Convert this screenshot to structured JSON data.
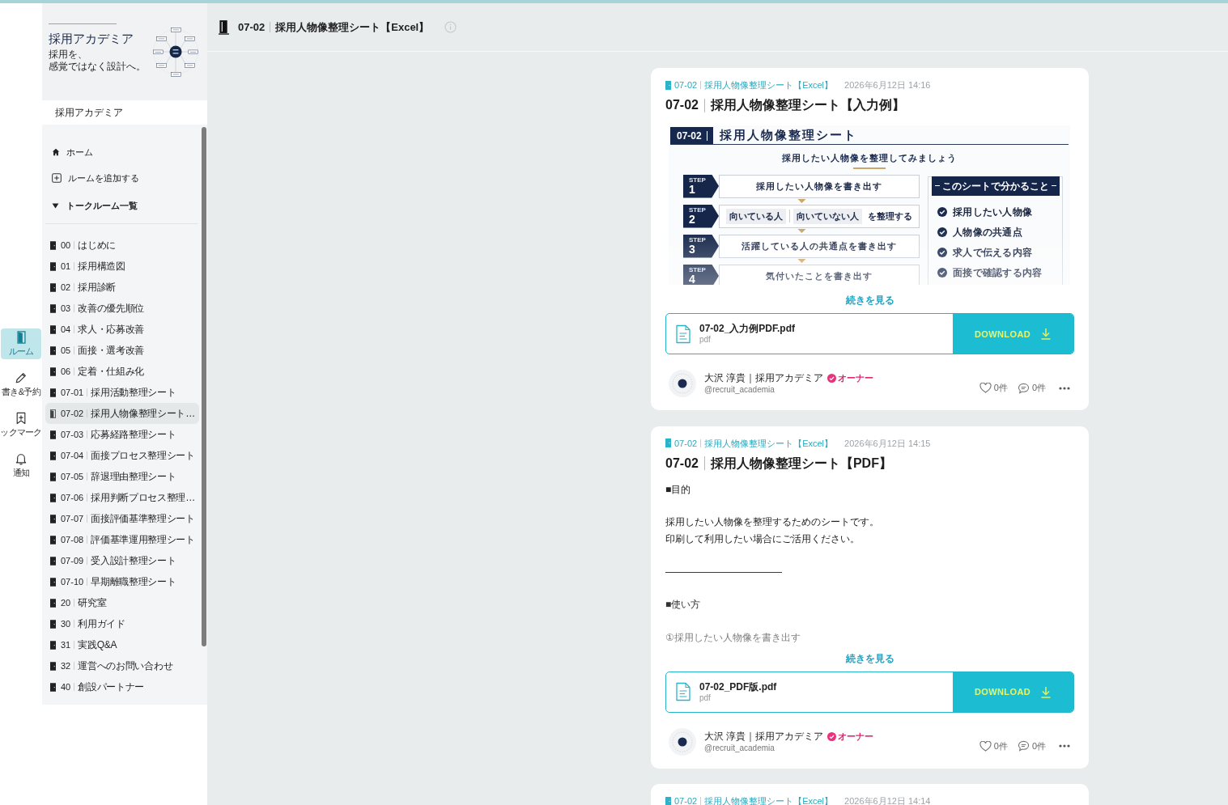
{
  "rail": {
    "items": [
      {
        "kind": "rooms",
        "label": "ルーム",
        "selected": true
      },
      {
        "kind": "drafts",
        "label": "書き&予約",
        "selected": false
      },
      {
        "kind": "bookmarks",
        "label": "ックマーク",
        "selected": false
      },
      {
        "kind": "notifications",
        "label": "通知",
        "selected": false
      }
    ]
  },
  "sidebar": {
    "cover": {
      "title": "採用アカデミア",
      "tagline": [
        "採用を、",
        "感覚ではなく設計へ。"
      ]
    },
    "room_name": "採用アカデミア",
    "nav": [
      {
        "kind": "home",
        "label": "ホーム"
      },
      {
        "kind": "add",
        "label": "ルームを追加する"
      }
    ],
    "section": {
      "label": "トークルーム一覧",
      "expanded": true
    },
    "rooms": [
      {
        "number": "00",
        "name": "はじめに",
        "selected": false
      },
      {
        "number": "01",
        "name": "採用構造図",
        "selected": false
      },
      {
        "number": "02",
        "name": "採用診断",
        "selected": false
      },
      {
        "number": "03",
        "name": "改善の優先順位",
        "selected": false
      },
      {
        "number": "04",
        "name": "求人・応募改善",
        "selected": false
      },
      {
        "number": "05",
        "name": "面接・選考改善",
        "selected": false
      },
      {
        "number": "06",
        "name": "定着・仕組み化",
        "selected": false
      },
      {
        "number": "07-01",
        "name": "採用活動整理シート",
        "selected": false
      },
      {
        "number": "07-02",
        "name": "採用人物像整理シート…",
        "selected": true
      },
      {
        "number": "07-03",
        "name": "応募経路整理シート",
        "selected": false
      },
      {
        "number": "07-04",
        "name": "面接プロセス整理シート",
        "selected": false
      },
      {
        "number": "07-05",
        "name": "辞退理由整理シート",
        "selected": false
      },
      {
        "number": "07-06",
        "name": "採用判断プロセス整理…",
        "selected": false
      },
      {
        "number": "07-07",
        "name": "面接評価基準整理シート",
        "selected": false
      },
      {
        "number": "07-08",
        "name": "評価基準運用整理シート",
        "selected": false
      },
      {
        "number": "07-09",
        "name": "受入設計整理シート",
        "selected": false
      },
      {
        "number": "07-10",
        "name": "早期離職整理シート",
        "selected": false
      },
      {
        "number": "20",
        "name": "研究室",
        "selected": false
      },
      {
        "number": "30",
        "name": "利用ガイド",
        "selected": false
      },
      {
        "number": "31",
        "name": "実践Q&A",
        "selected": false
      },
      {
        "number": "32",
        "name": "運営へのお問い合わせ",
        "selected": false
      },
      {
        "number": "40",
        "name": "創設パートナー",
        "selected": false
      }
    ]
  },
  "header": {
    "number": "07-02",
    "name": "採用人物像整理シート【Excel】"
  },
  "posts": [
    {
      "room": {
        "number": "07-02",
        "name": "採用人物像整理シート【Excel】"
      },
      "time": "2026年6月12日 14:16",
      "title": {
        "number": "07-02",
        "name": "採用人物像整理シート【入力例】"
      },
      "body": {
        "kind": "image",
        "collapsed": true,
        "sheet": {
          "number": "07-02",
          "title": "採用人物像整理シート",
          "subtitle": "採用したい人物像を整理してみましょう",
          "steps": [
            {
              "kind": "text",
              "label": "STEP",
              "number": "1",
              "text": "採用したい人物像を書き出す"
            },
            {
              "kind": "sort",
              "label": "STEP",
              "number": "2",
              "chips": [
                "向いている人",
                "向いていない人"
              ],
              "text": "を整理する"
            },
            {
              "kind": "text",
              "label": "STEP",
              "number": "3",
              "text": "活躍している人の共通点を書き出す"
            },
            {
              "kind": "text",
              "label": "STEP",
              "number": "4",
              "text": "気付いたことを書き出す"
            }
          ],
          "summary": {
            "title": "このシートで分かること",
            "items": [
              "採用したい人物像",
              "人物像の共通点",
              "求人で伝える内容",
              "面接で確認する内容"
            ]
          }
        }
      },
      "more": "続きを見る",
      "attachment": {
        "name": "07-02_入力例PDF.pdf",
        "type": "pdf",
        "action": "DOWNLOAD"
      },
      "author": {
        "name": "大沢 淳貴｜採用アカデミア",
        "verified": true,
        "role": "オーナー",
        "handle": "@recruit_academia"
      },
      "likes": "0件",
      "comments": "0件"
    },
    {
      "room": {
        "number": "07-02",
        "name": "採用人物像整理シート【Excel】"
      },
      "time": "2026年6月12日 14:15",
      "title": {
        "number": "07-02",
        "name": "採用人物像整理シート【PDF】"
      },
      "body": {
        "kind": "text",
        "collapsed": true,
        "paragraphs": [
          [
            "■目的"
          ],
          [
            "採用したい人物像を整理するためのシートです。",
            "印刷して利用したい場合にご活用ください。"
          ],
          [
            "――――――――――――"
          ],
          [
            "■使い方"
          ],
          [
            "①採用したい人物像を書き出す"
          ]
        ]
      },
      "more": "続きを見る",
      "attachment": {
        "name": "07-02_PDF版.pdf",
        "type": "pdf",
        "action": "DOWNLOAD"
      },
      "author": {
        "name": "大沢 淳貴｜採用アカデミア",
        "verified": true,
        "role": "オーナー",
        "handle": "@recruit_academia"
      },
      "likes": "0件",
      "comments": "0件"
    },
    {
      "room": {
        "number": "07-02",
        "name": "採用人物像整理シート【Excel】"
      },
      "time": "2026年6月12日 14:14"
    }
  ]
}
